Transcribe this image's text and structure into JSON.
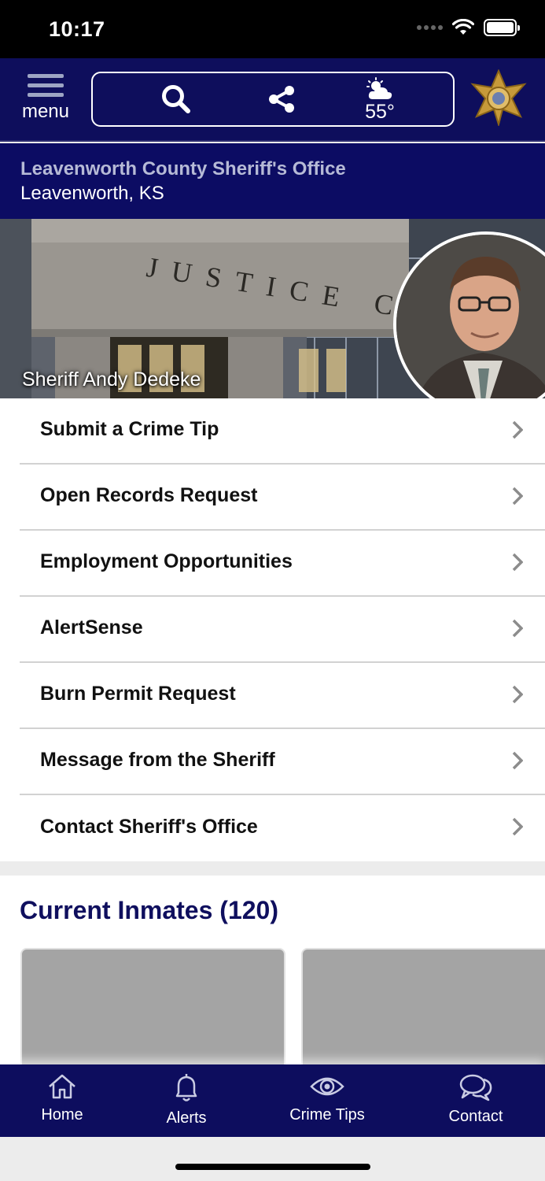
{
  "status_bar": {
    "time": "10:17"
  },
  "header": {
    "menu_label": "menu",
    "weather_temp": "55°",
    "icons": [
      "menu-icon",
      "search-icon",
      "share-icon",
      "partly-cloudy-icon",
      "sheriff-star-badge"
    ]
  },
  "agency": {
    "name": "Leavenworth County Sheriff's Office",
    "location": "Leavenworth, KS"
  },
  "hero": {
    "caption": "Sheriff Andy Dedeke",
    "building_text": "JUSTICE CENT"
  },
  "menu_items": [
    {
      "label": "Submit a Crime Tip"
    },
    {
      "label": "Open Records Request"
    },
    {
      "label": "Employment Opportunities"
    },
    {
      "label": "AlertSense"
    },
    {
      "label": "Burn Permit Request"
    },
    {
      "label": "Message from the Sheriff"
    },
    {
      "label": "Contact Sheriff's Office"
    }
  ],
  "inmates": {
    "title": "Current Inmates (120)"
  },
  "tabs": [
    {
      "label": "Home",
      "icon": "home-icon"
    },
    {
      "label": "Alerts",
      "icon": "bell-icon"
    },
    {
      "label": "Crime Tips",
      "icon": "eye-icon"
    },
    {
      "label": "Contact",
      "icon": "chat-bubbles-icon"
    }
  ],
  "colors": {
    "header_navy": "#0e0e5c",
    "title_navy": "#0f0f5e",
    "agency_name": "#b6bad6"
  }
}
